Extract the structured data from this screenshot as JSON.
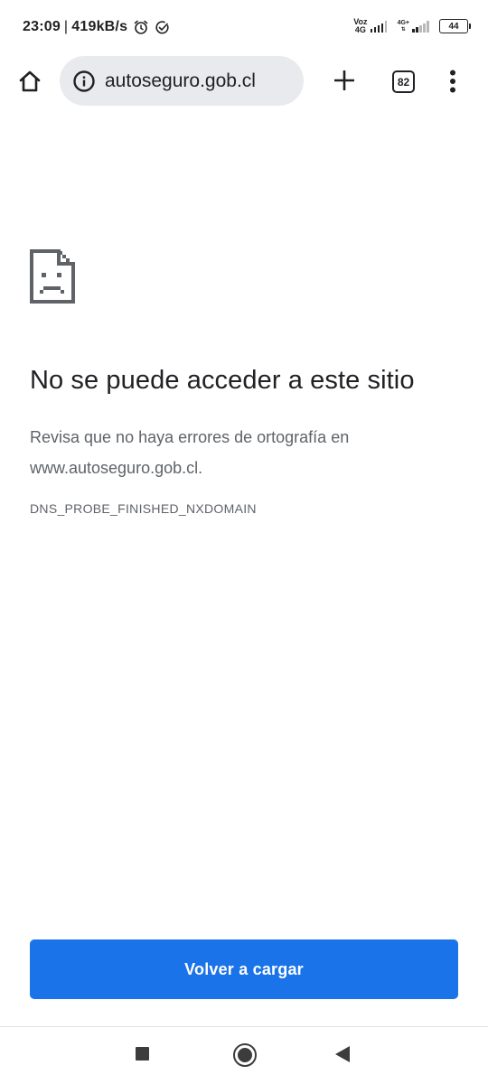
{
  "status_bar": {
    "time": "23:09",
    "separator": "|",
    "speed": "419kB/s",
    "alarm_icon": "alarm-clock-icon",
    "sync_icon": "check-circle-icon",
    "volte_line1": "Voz",
    "volte_line2": "4G",
    "net_type": "4G+",
    "battery": "44"
  },
  "toolbar": {
    "home_icon": "home-icon",
    "info_icon": "info-circle-icon",
    "url": "autoseguro.gob.cl",
    "new_tab_icon": "plus-icon",
    "tab_count": "82",
    "menu_icon": "vertical-dots-icon"
  },
  "error_page": {
    "icon": "sad-document-icon",
    "title": "No se puede acceder a este sitio",
    "message": "Revisa que no haya errores de ortografía en www.autoseguro.gob.cl.",
    "error_code": "DNS_PROBE_FINISHED_NXDOMAIN",
    "reload_label": "Volver a cargar"
  },
  "nav_bar": {
    "recents_icon": "square-icon",
    "home_icon": "circle-home-icon",
    "back_icon": "triangle-back-icon"
  },
  "colors": {
    "accent": "#1a73e8",
    "omnibox_bg": "#e8eaed",
    "secondary_text": "#5f6368"
  }
}
